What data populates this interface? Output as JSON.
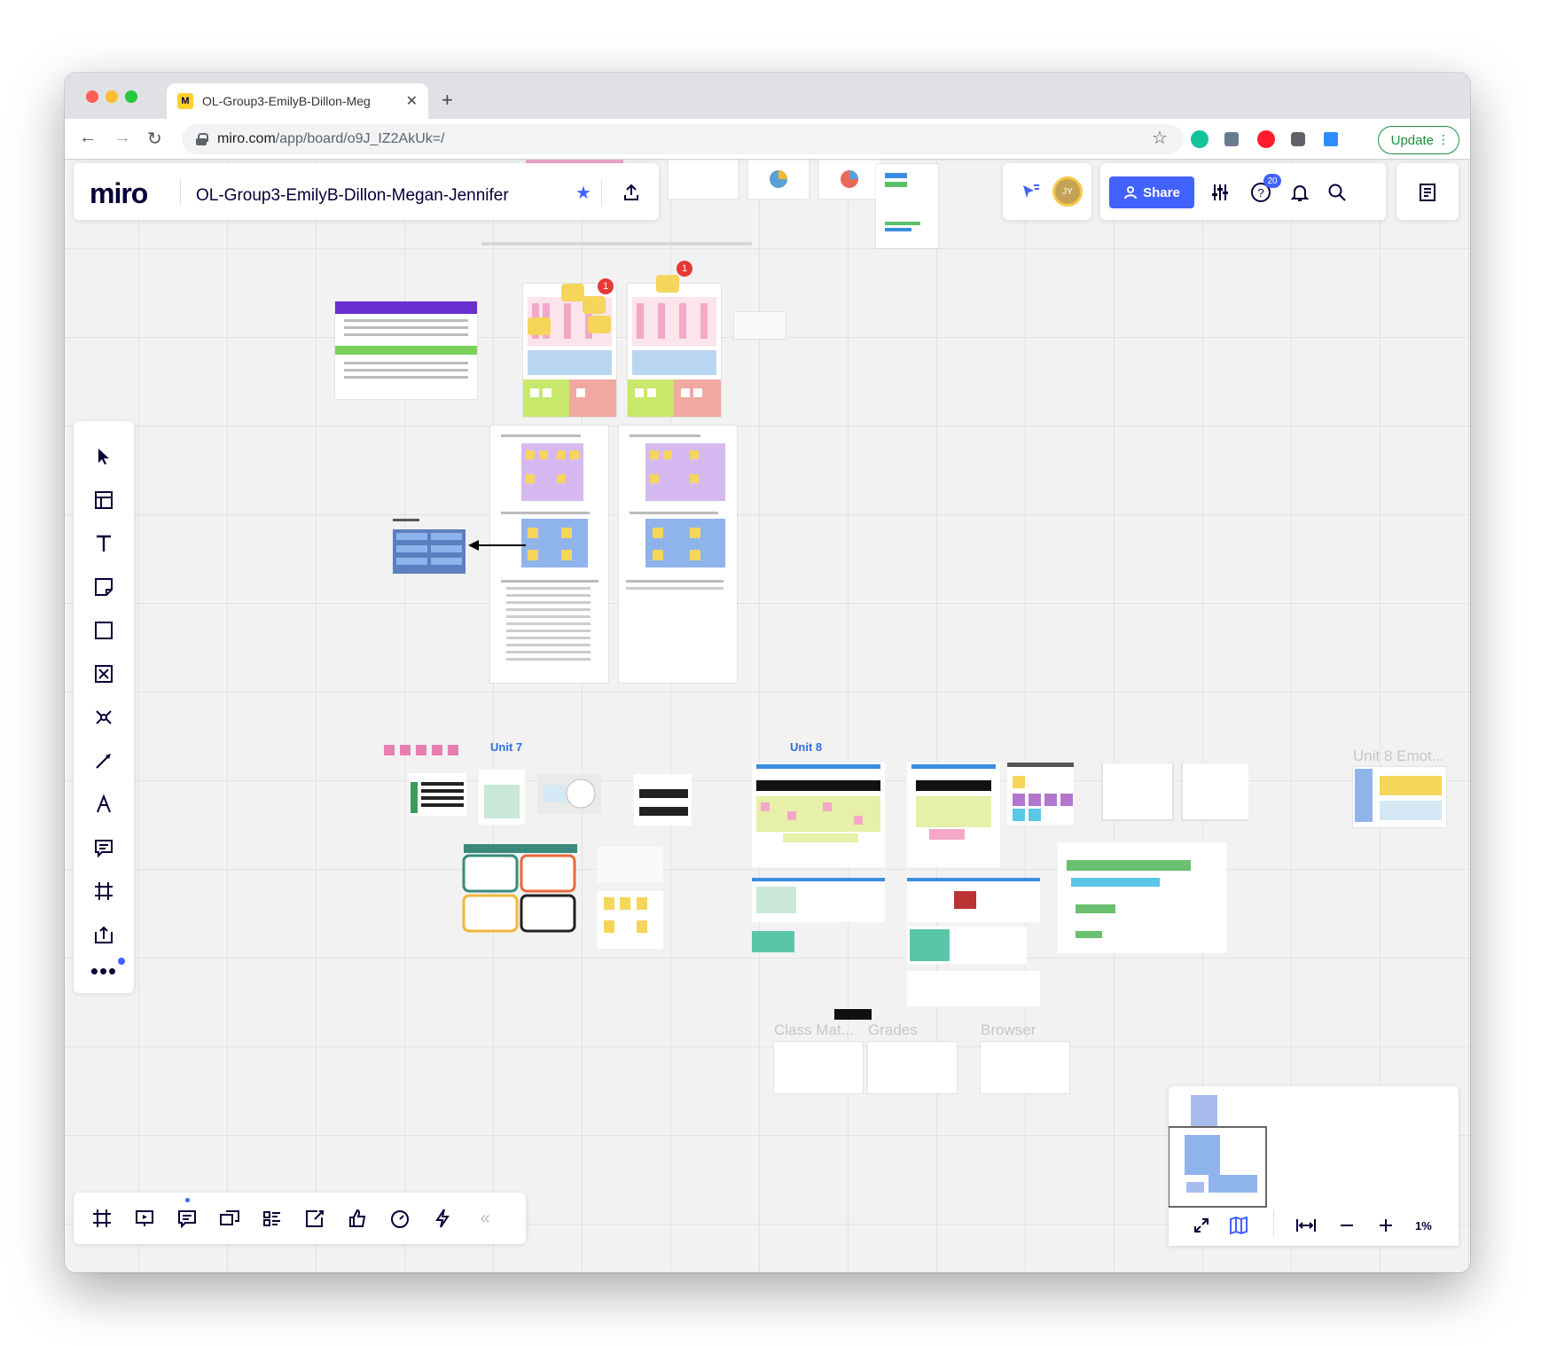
{
  "browser": {
    "tab_title": "OL-Group3-EmilyB-Dillon-Meg",
    "tab_close": "✕",
    "new_tab": "+",
    "url_host": "miro.com",
    "url_path": "/app/board/o9J_IZ2AkUk=/",
    "update_label": "Update",
    "nav_back": "←",
    "nav_forward": "→",
    "nav_reload": "↻",
    "bookmark": "☆"
  },
  "miro": {
    "logo": "miro",
    "board_title": "OL-Group3-EmilyB-Dillon-Megan-Jennifer",
    "star": "★",
    "share_label": "Share",
    "help_badge": "20",
    "avatar_initials": "JY",
    "zoom_level": "1%",
    "collapse": "«"
  },
  "canvas": {
    "unit7_label": "Unit 7",
    "unit8_label": "Unit 8",
    "unit8_emot_label": "Unit 8 Emot...",
    "class_mat_label": "Class Mat...",
    "grades_label": "Grades",
    "browser_label": "Browser",
    "comment_count_1": "1",
    "comment_count_2": "1"
  },
  "colors": {
    "accent": "#4262ff",
    "canvas_bg": "#f2f2f2",
    "sticky_yellow": "#f5d55a",
    "sticky_pink": "#f3a8c8",
    "sticky_purple": "#d6b9f0",
    "sticky_blue": "#8fb4ec",
    "sticky_green": "#c7e86a"
  }
}
